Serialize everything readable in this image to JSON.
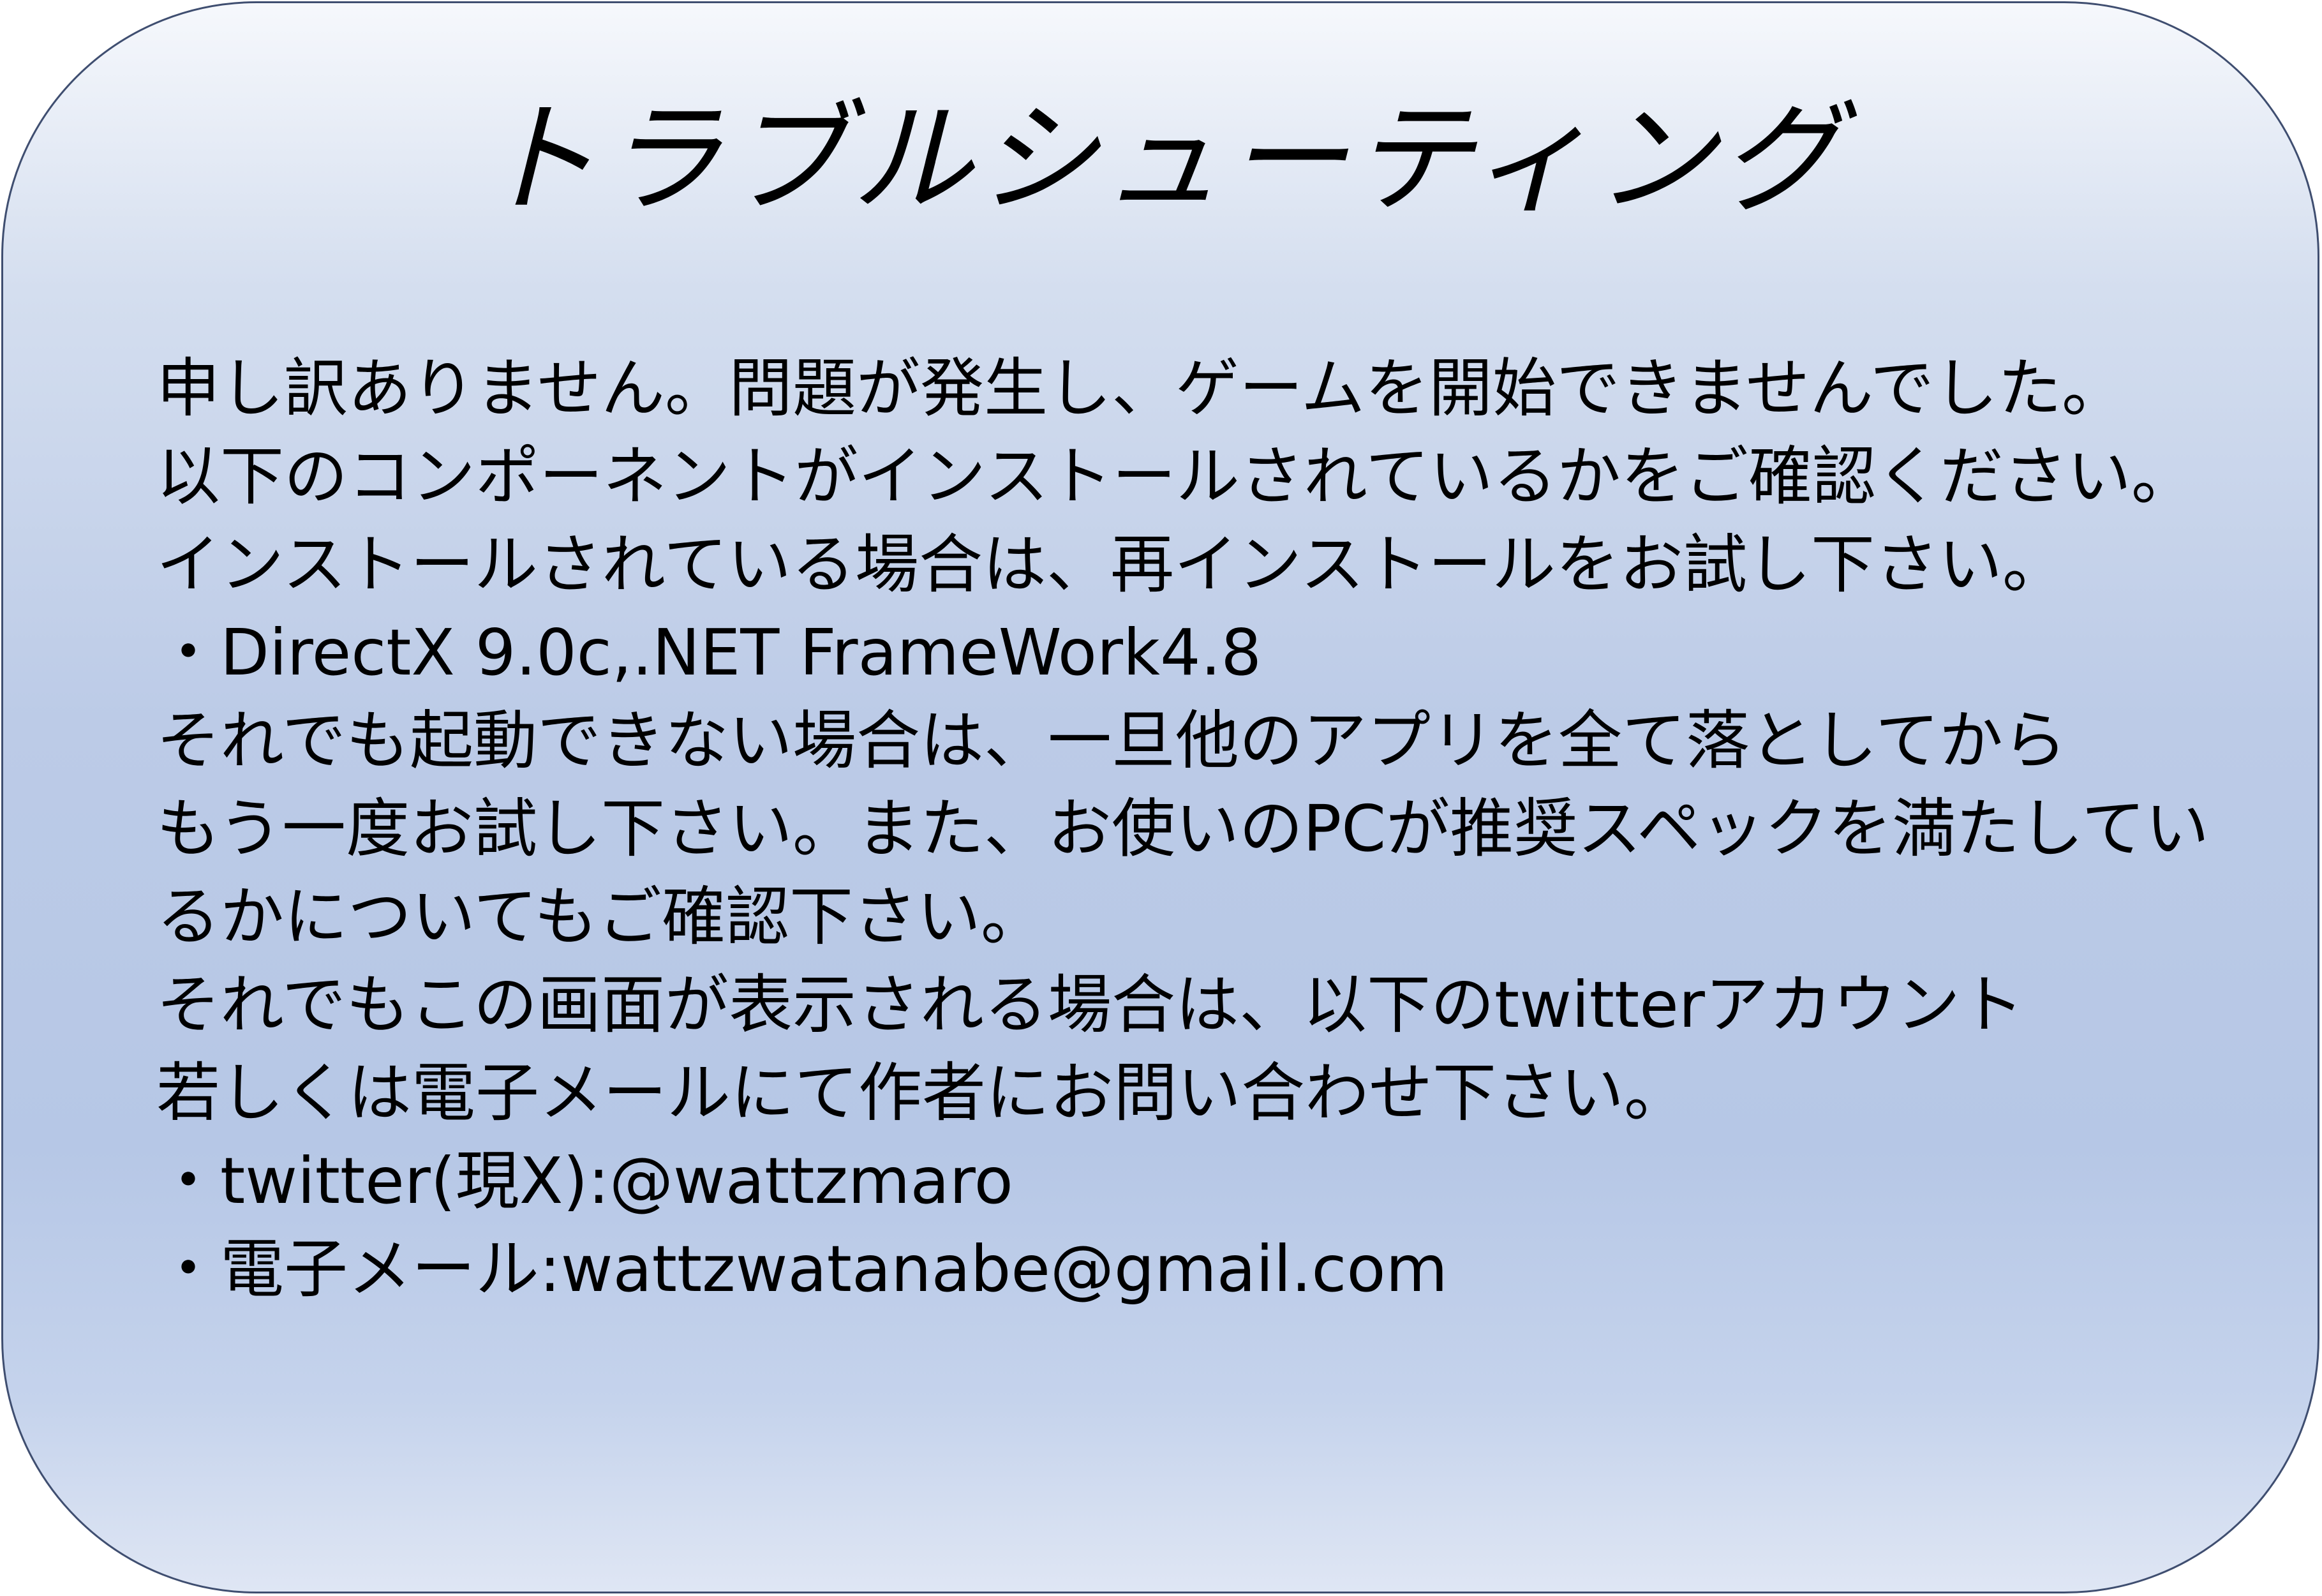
{
  "dialog": {
    "title": "トラブルシューティング",
    "lines": [
      "申し訳ありません。問題が発生し、ゲームを開始できませんでした。",
      "以下のコンポーネントがインストールされているかをご確認ください。",
      "インストールされている場合は、再インストールをお試し下さい。",
      "・DirectX 9.0c,.NET FrameWork4.8",
      "それでも起動できない場合は、一旦他のアプリを全て落としてから",
      "もう一度お試し下さい。また、お使いのPCが推奨スペックを満たしてい",
      "るかについてもご確認下さい。",
      "それでもこの画面が表示される場合は、以下のtwitterアカウント",
      "若しくは電子メールにて作者にお問い合わせ下さい。",
      "・twitter(現X):@wattzmaro",
      "・電子メール:wattzwatanabe@gmail.com"
    ]
  },
  "colors": {
    "border": "#3f4e70",
    "gradient_top": "#f6f8fc",
    "gradient_mid": "#b6c7e6",
    "text": "#000000"
  }
}
